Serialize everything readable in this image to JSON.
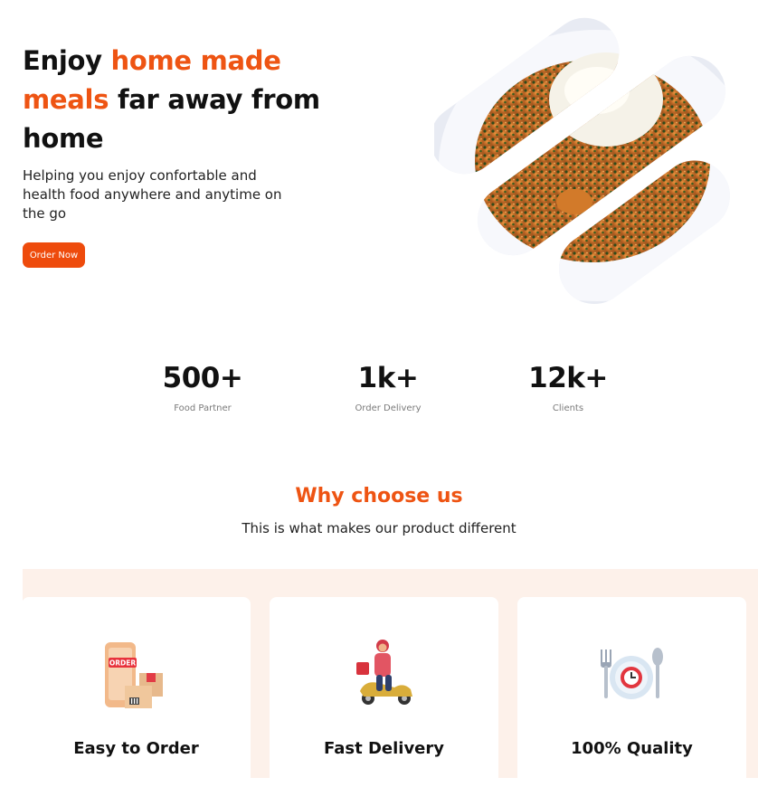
{
  "hero": {
    "title_part1": "Enjoy ",
    "title_accent1": "home made",
    "title_accent2": "meals",
    "title_part2": " far away from home",
    "subtitle": "Helping you enjoy confortable and health food anywhere and anytime on the go",
    "cta_label": "Order Now",
    "image_alt": "Plate of egusi soup with pounded yam"
  },
  "stats": [
    {
      "value": "500+",
      "label": "Food Partner"
    },
    {
      "value": "1k+",
      "label": "Order Delivery"
    },
    {
      "value": "12k+",
      "label": "Clients"
    }
  ],
  "why": {
    "title": "Why choose us",
    "subtitle": "This is what makes our product different"
  },
  "features": [
    {
      "title": "Easy to Order",
      "icon": "order-phone-icon",
      "badge": "ORDER"
    },
    {
      "title": "Fast Delivery",
      "icon": "delivery-scooter-icon"
    },
    {
      "title": "100% Quality",
      "icon": "plate-cutlery-icon"
    }
  ],
  "colors": {
    "accent": "#ee5413",
    "button": "#ee4b0c",
    "section_bg": "#fdf1ea"
  }
}
